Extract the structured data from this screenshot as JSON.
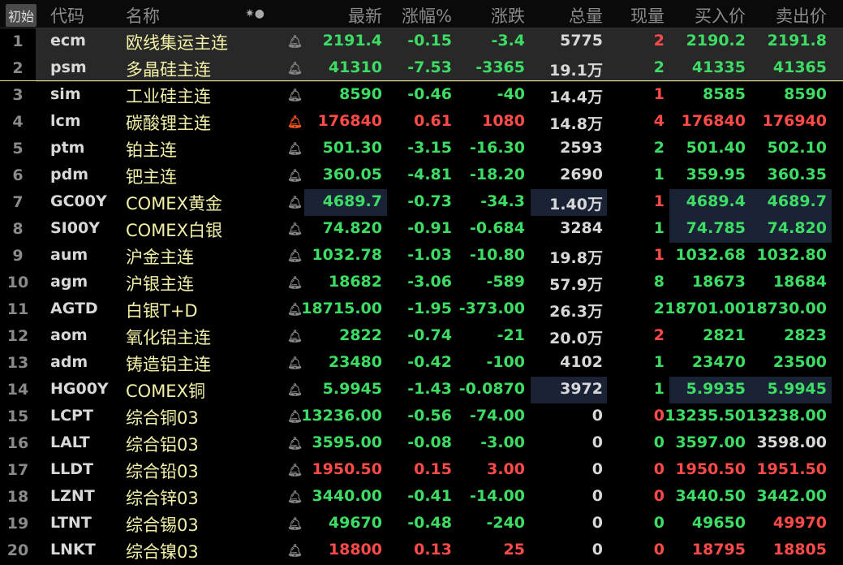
{
  "header": {
    "init": "初始",
    "code": "代码",
    "name": "名称",
    "icons": "✷●",
    "latest": "最新",
    "pct": "涨幅%",
    "chg": "涨跌",
    "vol": "总量",
    "cur": "现量",
    "bid": "买入价",
    "ask": "卖出价"
  },
  "rows": [
    {
      "i": "1",
      "code": "ecm",
      "name": "欧线集运主连",
      "alert": false,
      "last": "2191.4",
      "pct": "-0.15",
      "chg": "-3.4",
      "vol": "5775",
      "cur": "2",
      "bid": "2190.2",
      "ask": "2191.8",
      "c": [
        "g",
        "g",
        "g",
        "w",
        "rd",
        "g",
        "g"
      ]
    },
    {
      "i": "2",
      "code": "psm",
      "name": "多晶硅主连",
      "alert": false,
      "last": "41310",
      "pct": "-7.53",
      "chg": "-3365",
      "vol": "19.1万",
      "cur": "2",
      "bid": "41335",
      "ask": "41365",
      "c": [
        "g",
        "g",
        "g",
        "w",
        "g",
        "g",
        "g"
      ]
    },
    {
      "i": "3",
      "code": "sim",
      "name": "工业硅主连",
      "alert": false,
      "last": "8590",
      "pct": "-0.46",
      "chg": "-40",
      "vol": "14.4万",
      "cur": "1",
      "bid": "8585",
      "ask": "8590",
      "c": [
        "g",
        "g",
        "g",
        "w",
        "rd",
        "g",
        "g"
      ]
    },
    {
      "i": "4",
      "code": "lcm",
      "name": "碳酸锂主连",
      "alert": true,
      "last": "176840",
      "pct": "0.61",
      "chg": "1080",
      "vol": "14.8万",
      "cur": "4",
      "bid": "176840",
      "ask": "176940",
      "c": [
        "rd",
        "rd",
        "rd",
        "w",
        "rd",
        "rd",
        "rd"
      ]
    },
    {
      "i": "5",
      "code": "ptm",
      "name": "铂主连",
      "alert": false,
      "last": "501.30",
      "pct": "-3.15",
      "chg": "-16.30",
      "vol": "2593",
      "cur": "2",
      "bid": "501.40",
      "ask": "502.10",
      "c": [
        "g",
        "g",
        "g",
        "w",
        "g",
        "g",
        "g"
      ]
    },
    {
      "i": "6",
      "code": "pdm",
      "name": "钯主连",
      "alert": false,
      "last": "360.05",
      "pct": "-4.81",
      "chg": "-18.20",
      "vol": "2690",
      "cur": "1",
      "bid": "359.95",
      "ask": "360.35",
      "c": [
        "g",
        "g",
        "g",
        "w",
        "g",
        "g",
        "g"
      ]
    },
    {
      "i": "7",
      "code": "GC00Y",
      "name": "COMEX黄金",
      "alert": false,
      "last": "4689.7",
      "pct": "-0.73",
      "chg": "-34.3",
      "vol": "1.40万",
      "cur": "1",
      "bid": "4689.4",
      "ask": "4689.7",
      "c": [
        "g",
        "g",
        "g",
        "w",
        "rd",
        "g",
        "g"
      ]
    },
    {
      "i": "8",
      "code": "SI00Y",
      "name": "COMEX白银",
      "alert": false,
      "last": "74.820",
      "pct": "-0.91",
      "chg": "-0.684",
      "vol": "3284",
      "cur": "1",
      "bid": "74.785",
      "ask": "74.820",
      "c": [
        "g",
        "g",
        "g",
        "w",
        "g",
        "g",
        "g"
      ]
    },
    {
      "i": "9",
      "code": "aum",
      "name": "沪金主连",
      "alert": false,
      "last": "1032.78",
      "pct": "-1.03",
      "chg": "-10.80",
      "vol": "19.8万",
      "cur": "1",
      "bid": "1032.68",
      "ask": "1032.80",
      "c": [
        "g",
        "g",
        "g",
        "w",
        "rd",
        "g",
        "g"
      ]
    },
    {
      "i": "10",
      "code": "agm",
      "name": "沪银主连",
      "alert": false,
      "last": "18682",
      "pct": "-3.06",
      "chg": "-589",
      "vol": "57.9万",
      "cur": "8",
      "bid": "18673",
      "ask": "18684",
      "c": [
        "g",
        "g",
        "g",
        "w",
        "g",
        "g",
        "g"
      ]
    },
    {
      "i": "11",
      "code": "AGTD",
      "name": "白银T+D",
      "alert": false,
      "last": "18715.00",
      "pct": "-1.95",
      "chg": "-373.00",
      "vol": "26.3万",
      "cur": "2",
      "bid": "18701.00",
      "ask": "18730.00",
      "c": [
        "g",
        "g",
        "g",
        "w",
        "g",
        "g",
        "g"
      ]
    },
    {
      "i": "12",
      "code": "aom",
      "name": "氧化铝主连",
      "alert": false,
      "last": "2822",
      "pct": "-0.74",
      "chg": "-21",
      "vol": "20.0万",
      "cur": "2",
      "bid": "2821",
      "ask": "2823",
      "c": [
        "g",
        "g",
        "g",
        "w",
        "rd",
        "g",
        "g"
      ]
    },
    {
      "i": "13",
      "code": "adm",
      "name": "铸造铝主连",
      "alert": false,
      "last": "23480",
      "pct": "-0.42",
      "chg": "-100",
      "vol": "4102",
      "cur": "1",
      "bid": "23470",
      "ask": "23500",
      "c": [
        "g",
        "g",
        "g",
        "w",
        "g",
        "g",
        "g"
      ]
    },
    {
      "i": "14",
      "code": "HG00Y",
      "name": "COMEX铜",
      "alert": false,
      "last": "5.9945",
      "pct": "-1.43",
      "chg": "-0.0870",
      "vol": "3972",
      "cur": "1",
      "bid": "5.9935",
      "ask": "5.9945",
      "c": [
        "g",
        "g",
        "g",
        "w",
        "g",
        "g",
        "g"
      ]
    },
    {
      "i": "15",
      "code": "LCPT",
      "name": "综合铜03",
      "alert": false,
      "last": "13236.00",
      "pct": "-0.56",
      "chg": "-74.00",
      "vol": "0",
      "cur": "0",
      "bid": "13235.50",
      "ask": "13238.00",
      "c": [
        "g",
        "g",
        "g",
        "w",
        "rd",
        "g",
        "g"
      ]
    },
    {
      "i": "16",
      "code": "LALT",
      "name": "综合铝03",
      "alert": false,
      "last": "3595.00",
      "pct": "-0.08",
      "chg": "-3.00",
      "vol": "0",
      "cur": "0",
      "bid": "3597.00",
      "ask": "3598.00",
      "c": [
        "g",
        "g",
        "g",
        "w",
        "g",
        "g",
        "w"
      ]
    },
    {
      "i": "17",
      "code": "LLDT",
      "name": "综合铅03",
      "alert": false,
      "last": "1950.50",
      "pct": "0.15",
      "chg": "3.00",
      "vol": "0",
      "cur": "0",
      "bid": "1950.50",
      "ask": "1951.50",
      "c": [
        "rd",
        "rd",
        "rd",
        "w",
        "rd",
        "rd",
        "rd"
      ]
    },
    {
      "i": "18",
      "code": "LZNT",
      "name": "综合锌03",
      "alert": false,
      "last": "3440.00",
      "pct": "-0.41",
      "chg": "-14.00",
      "vol": "0",
      "cur": "0",
      "bid": "3440.50",
      "ask": "3442.00",
      "c": [
        "g",
        "g",
        "g",
        "w",
        "rd",
        "g",
        "g"
      ]
    },
    {
      "i": "19",
      "code": "LTNT",
      "name": "综合锡03",
      "alert": false,
      "last": "49670",
      "pct": "-0.48",
      "chg": "-240",
      "vol": "0",
      "cur": "0",
      "bid": "49650",
      "ask": "49970",
      "c": [
        "g",
        "g",
        "g",
        "w",
        "g",
        "g",
        "rd"
      ]
    },
    {
      "i": "20",
      "code": "LNKT",
      "name": "综合镍03",
      "alert": false,
      "last": "18800",
      "pct": "0.13",
      "chg": "25",
      "vol": "0",
      "cur": "0",
      "bid": "18795",
      "ask": "18805",
      "c": [
        "rd",
        "rd",
        "rd",
        "w",
        "rd",
        "rd",
        "rd"
      ]
    }
  ]
}
